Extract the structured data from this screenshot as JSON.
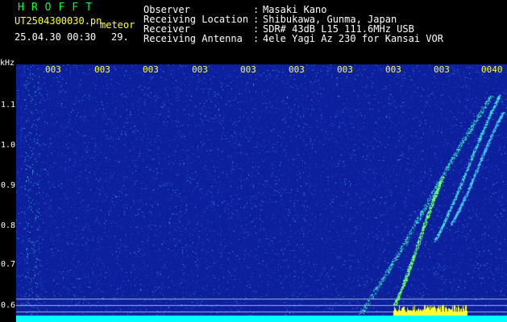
{
  "header": {
    "brand": "HROFFT",
    "file_name": "UT2504300030.pn",
    "meteor_label": "meteor",
    "datetime": "25.04.30 00:30",
    "count": "29.",
    "info": [
      {
        "label": "Observer",
        "value": "Masaki Kano"
      },
      {
        "label": "Receiving Location",
        "value": "Shibukawa, Gunma, Japan"
      },
      {
        "label": "Receiver",
        "value": "SDR# 43dB L15 111.6MHz USB"
      },
      {
        "label": "Receiving Antenna",
        "value": "4ele Yagi Az 230 for Kansai VOR"
      }
    ]
  },
  "spectrogram": {
    "y_unit": "kHz",
    "y_ticks": [
      "1.1",
      "1.0",
      "0.9",
      "0.8",
      "0.7",
      "0.6"
    ],
    "time_ticks": [
      "003",
      "003",
      "003",
      "003",
      "003",
      "003",
      "003",
      "003",
      "003",
      "0040"
    ],
    "colors": {
      "background": "#0c1f9c",
      "signal": "#33ffcc",
      "noise_floor": "#00ffff",
      "burst": "#ffff33"
    }
  }
}
